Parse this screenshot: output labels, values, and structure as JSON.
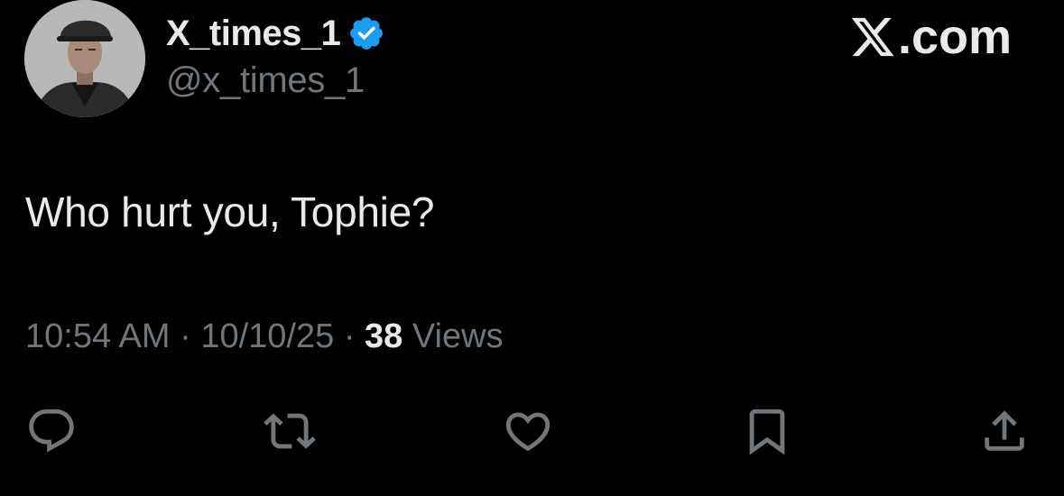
{
  "author": {
    "display_name": "X_times_1",
    "handle": "@x_times_1",
    "verified": true,
    "verified_color": "#1d9bf0",
    "avatar_icon": "profile-photo"
  },
  "brand": {
    "label": ".com",
    "logo_icon": "x-logo-icon"
  },
  "tweet": {
    "text": "Who hurt you, Tophie?"
  },
  "meta": {
    "time": "10:54 AM",
    "separator": "·",
    "date": "10/10/25",
    "views_count": "38",
    "views_label": "Views"
  },
  "actions": [
    {
      "name": "reply",
      "icon": "reply-icon"
    },
    {
      "name": "repost",
      "icon": "repost-icon"
    },
    {
      "name": "like",
      "icon": "heart-icon"
    },
    {
      "name": "bookmark",
      "icon": "bookmark-icon"
    },
    {
      "name": "share",
      "icon": "share-icon"
    }
  ],
  "colors": {
    "background": "#000000",
    "primary_text": "#e7e9ea",
    "secondary_text": "#71767b"
  }
}
